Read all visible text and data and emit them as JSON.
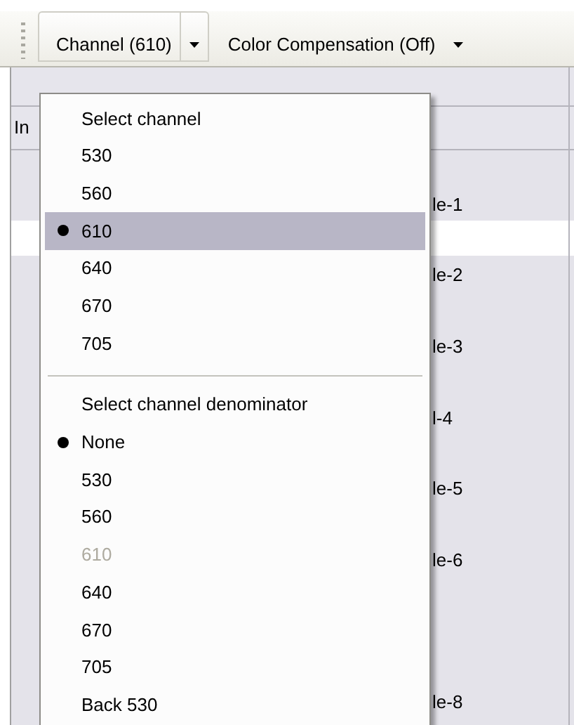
{
  "toolbar": {
    "buttons": [
      {
        "label": "Channel (610)",
        "pressed": true
      },
      {
        "label": "Color Compensation (Off)",
        "pressed": false
      }
    ]
  },
  "grid": {
    "column_header": "In",
    "rows": [
      {
        "kind": "labeled",
        "label": "le-1"
      },
      {
        "kind": "labeled",
        "label": "le-2"
      },
      {
        "kind": "labeled",
        "label": "le-3"
      },
      {
        "kind": "labeled",
        "label": "l-4"
      },
      {
        "kind": "labeled",
        "label": "le-5"
      },
      {
        "kind": "labeled",
        "label": "le-6"
      },
      {
        "kind": "blank"
      },
      {
        "kind": "labeled",
        "label": "le-8"
      }
    ]
  },
  "menu": {
    "sections": [
      {
        "heading": "Select channel",
        "items": [
          {
            "label": "530",
            "checked": false,
            "highlighted": false,
            "disabled": false
          },
          {
            "label": "560",
            "checked": false,
            "highlighted": false,
            "disabled": false
          },
          {
            "label": "610",
            "checked": true,
            "highlighted": true,
            "disabled": false
          },
          {
            "label": "640",
            "checked": false,
            "highlighted": false,
            "disabled": false
          },
          {
            "label": "670",
            "checked": false,
            "highlighted": false,
            "disabled": false
          },
          {
            "label": "705",
            "checked": false,
            "highlighted": false,
            "disabled": false
          }
        ]
      },
      {
        "heading": "Select channel denominator",
        "items": [
          {
            "label": "None",
            "checked": true,
            "highlighted": false,
            "disabled": false
          },
          {
            "label": "530",
            "checked": false,
            "highlighted": false,
            "disabled": false
          },
          {
            "label": "560",
            "checked": false,
            "highlighted": false,
            "disabled": false
          },
          {
            "label": "610",
            "checked": false,
            "highlighted": false,
            "disabled": true
          },
          {
            "label": "640",
            "checked": false,
            "highlighted": false,
            "disabled": false
          },
          {
            "label": "670",
            "checked": false,
            "highlighted": false,
            "disabled": false
          },
          {
            "label": "705",
            "checked": false,
            "highlighted": false,
            "disabled": false
          },
          {
            "label": "Back 530",
            "checked": false,
            "highlighted": false,
            "disabled": false
          }
        ]
      }
    ]
  }
}
